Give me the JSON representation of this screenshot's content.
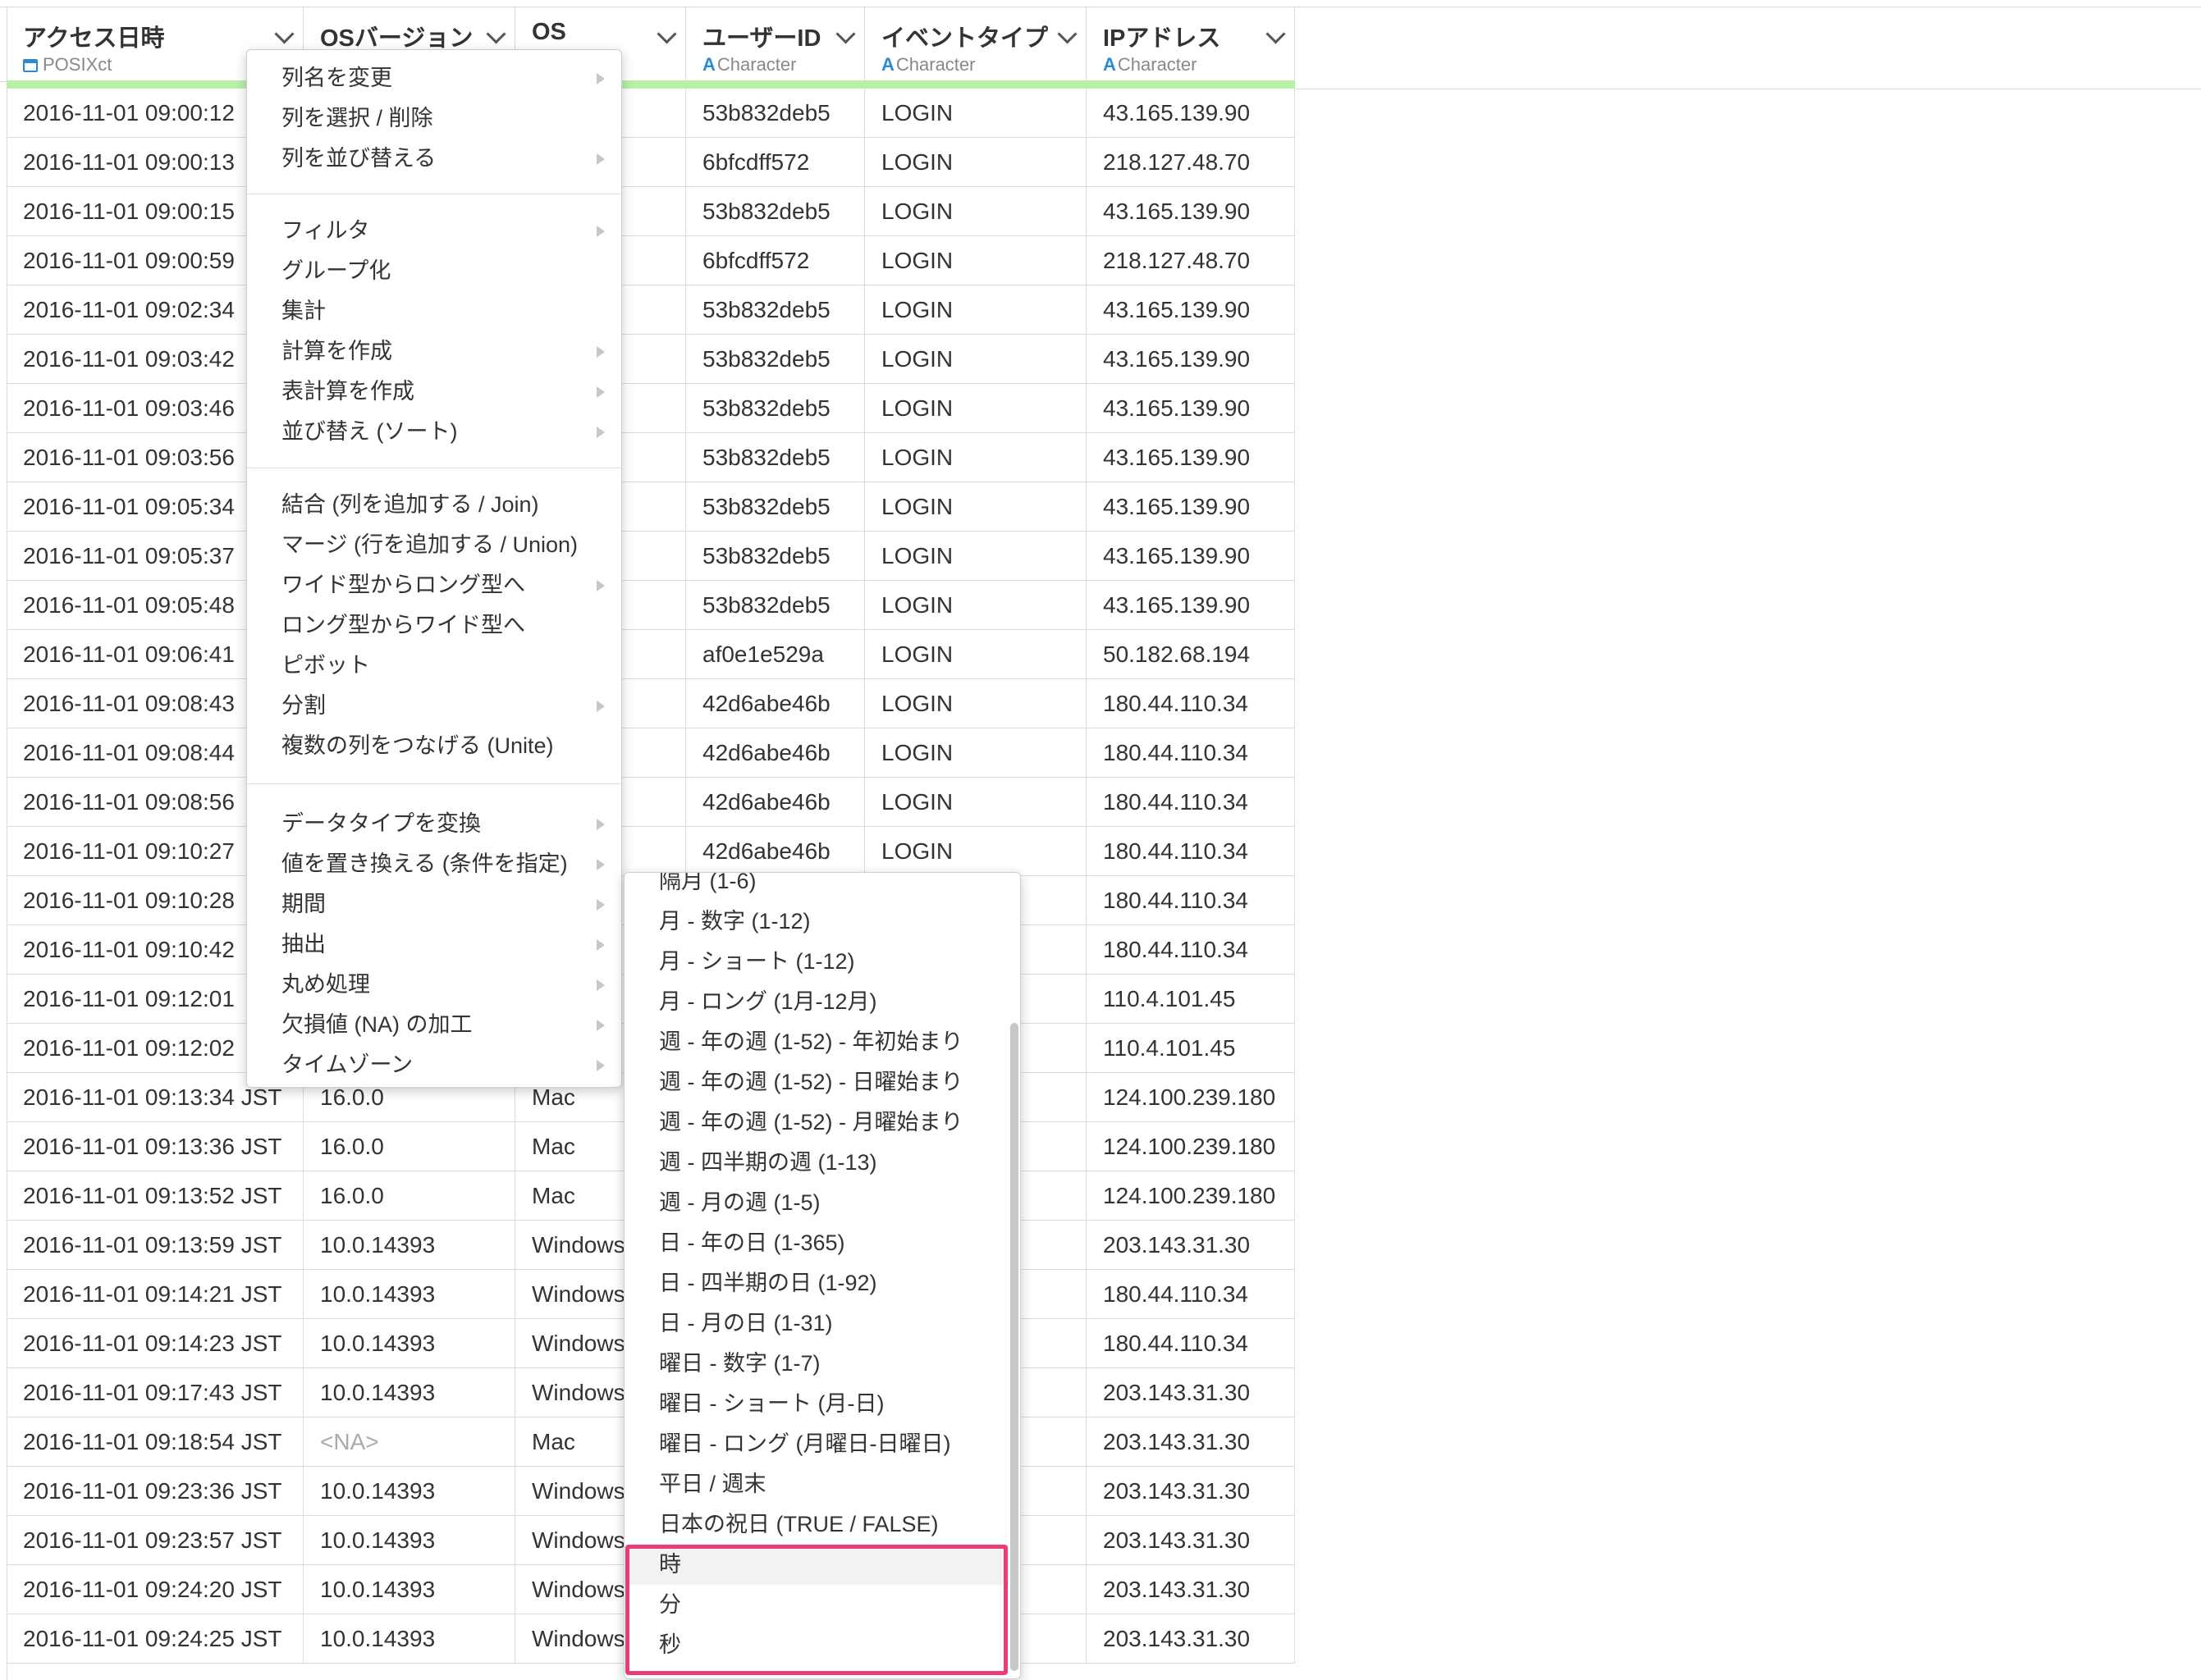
{
  "columns": [
    {
      "title": "アクセス日時",
      "type": "POSIXct",
      "type_icon": "calendar-icon"
    },
    {
      "title": "OSバージョン",
      "type": "",
      "type_icon": ""
    },
    {
      "title": "OS",
      "type": "",
      "type_icon": ""
    },
    {
      "title": "ユーザーID",
      "type": "Character",
      "type_icon": "A"
    },
    {
      "title": "イベントタイプ",
      "type": "Character",
      "type_icon": "A"
    },
    {
      "title": "IPアドレス",
      "type": "Character",
      "type_icon": "A"
    }
  ],
  "rows": [
    [
      "2016-11-01 09:00:12",
      "",
      "",
      "53b832deb5",
      "LOGIN",
      "43.165.139.90"
    ],
    [
      "2016-11-01 09:00:13",
      "",
      "",
      "6bfcdff572",
      "LOGIN",
      "218.127.48.70"
    ],
    [
      "2016-11-01 09:00:15",
      "",
      "",
      "53b832deb5",
      "LOGIN",
      "43.165.139.90"
    ],
    [
      "2016-11-01 09:00:59",
      "",
      "",
      "6bfcdff572",
      "LOGIN",
      "218.127.48.70"
    ],
    [
      "2016-11-01 09:02:34",
      "",
      "",
      "53b832deb5",
      "LOGIN",
      "43.165.139.90"
    ],
    [
      "2016-11-01 09:03:42",
      "",
      "",
      "53b832deb5",
      "LOGIN",
      "43.165.139.90"
    ],
    [
      "2016-11-01 09:03:46",
      "",
      "",
      "53b832deb5",
      "LOGIN",
      "43.165.139.90"
    ],
    [
      "2016-11-01 09:03:56",
      "",
      "",
      "53b832deb5",
      "LOGIN",
      "43.165.139.90"
    ],
    [
      "2016-11-01 09:05:34",
      "",
      "",
      "53b832deb5",
      "LOGIN",
      "43.165.139.90"
    ],
    [
      "2016-11-01 09:05:37",
      "",
      "",
      "53b832deb5",
      "LOGIN",
      "43.165.139.90"
    ],
    [
      "2016-11-01 09:05:48",
      "",
      "",
      "53b832deb5",
      "LOGIN",
      "43.165.139.90"
    ],
    [
      "2016-11-01 09:06:41",
      "",
      "",
      "af0e1e529a",
      "LOGIN",
      "50.182.68.194"
    ],
    [
      "2016-11-01 09:08:43",
      "",
      "",
      "42d6abe46b",
      "LOGIN",
      "180.44.110.34"
    ],
    [
      "2016-11-01 09:08:44",
      "",
      "",
      "42d6abe46b",
      "LOGIN",
      "180.44.110.34"
    ],
    [
      "2016-11-01 09:08:56",
      "",
      "",
      "42d6abe46b",
      "LOGIN",
      "180.44.110.34"
    ],
    [
      "2016-11-01 09:10:27",
      "",
      "",
      "42d6abe46b",
      "LOGIN",
      "180.44.110.34"
    ],
    [
      "2016-11-01 09:10:28",
      "",
      "",
      "",
      "",
      "180.44.110.34"
    ],
    [
      "2016-11-01 09:10:42",
      "",
      "",
      "",
      "",
      "180.44.110.34"
    ],
    [
      "2016-11-01 09:12:01",
      "",
      "",
      "",
      "",
      "110.4.101.45"
    ],
    [
      "2016-11-01 09:12:02",
      "",
      "",
      "",
      "",
      "110.4.101.45"
    ],
    [
      "2016-11-01 09:13:34 JST",
      "16.0.0",
      "Mac",
      "",
      "",
      "124.100.239.180"
    ],
    [
      "2016-11-01 09:13:36 JST",
      "16.0.0",
      "Mac",
      "",
      "",
      "124.100.239.180"
    ],
    [
      "2016-11-01 09:13:52 JST",
      "16.0.0",
      "Mac",
      "",
      "",
      "124.100.239.180"
    ],
    [
      "2016-11-01 09:13:59 JST",
      "10.0.14393",
      "Windows",
      "",
      "",
      "203.143.31.30"
    ],
    [
      "2016-11-01 09:14:21 JST",
      "10.0.14393",
      "Windows",
      "",
      "",
      "180.44.110.34"
    ],
    [
      "2016-11-01 09:14:23 JST",
      "10.0.14393",
      "Windows",
      "",
      "",
      "180.44.110.34"
    ],
    [
      "2016-11-01 09:17:43 JST",
      "10.0.14393",
      "Windows",
      "",
      "",
      "203.143.31.30"
    ],
    [
      "2016-11-01 09:18:54 JST",
      "<NA>",
      "Mac",
      "",
      "",
      "203.143.31.30"
    ],
    [
      "2016-11-01 09:23:36 JST",
      "10.0.14393",
      "Windows",
      "",
      "",
      "203.143.31.30"
    ],
    [
      "2016-11-01 09:23:57 JST",
      "10.0.14393",
      "Windows",
      "",
      "",
      "203.143.31.30"
    ],
    [
      "2016-11-01 09:24:20 JST",
      "10.0.14393",
      "Windows",
      "",
      "",
      "203.143.31.30"
    ],
    [
      "2016-11-01 09:24:25 JST",
      "10.0.14393",
      "Windows",
      "",
      "",
      "203.143.31.30"
    ]
  ],
  "context_menu": {
    "items": [
      {
        "label": "列名を変更",
        "submenu": true
      },
      {
        "label": "列を選択 / 削除",
        "submenu": false
      },
      {
        "label": "列を並び替える",
        "submenu": true
      },
      {
        "label": "フィルタ",
        "submenu": true
      },
      {
        "label": "グループ化",
        "submenu": false
      },
      {
        "label": "集計",
        "submenu": false
      },
      {
        "label": "計算を作成",
        "submenu": true
      },
      {
        "label": "表計算を作成",
        "submenu": true
      },
      {
        "label": "並び替え (ソート)",
        "submenu": true
      },
      {
        "label": "結合 (列を追加する / Join)",
        "submenu": false
      },
      {
        "label": "マージ (行を追加する / Union)",
        "submenu": false
      },
      {
        "label": "ワイド型からロング型へ",
        "submenu": true
      },
      {
        "label": "ロング型からワイド型へ",
        "submenu": false
      },
      {
        "label": "ピボット",
        "submenu": false
      },
      {
        "label": "分割",
        "submenu": true
      },
      {
        "label": "複数の列をつなげる (Unite)",
        "submenu": false
      },
      {
        "label": "データタイプを変換",
        "submenu": true
      },
      {
        "label": "値を置き換える (条件を指定)",
        "submenu": true
      },
      {
        "label": "期間",
        "submenu": true
      },
      {
        "label": "抽出",
        "submenu": true
      },
      {
        "label": "丸め処理",
        "submenu": true
      },
      {
        "label": "欠損値 (NA) の加工",
        "submenu": true
      },
      {
        "label": "タイムゾーン",
        "submenu": true
      }
    ]
  },
  "extract_submenu": {
    "items": [
      "隔月 (1-6)",
      "月 - 数字 (1-12)",
      "月 - ショート (1-12)",
      "月 - ロング (1月-12月)",
      "週 - 年の週 (1-52) - 年初始まり",
      "週 - 年の週 (1-52) - 日曜始まり",
      "週 - 年の週 (1-52) - 月曜始まり",
      "週 - 四半期の週 (1-13)",
      "週 - 月の週 (1-5)",
      "日 - 年の日 (1-365)",
      "日 - 四半期の日 (1-92)",
      "日 - 月の日 (1-31)",
      "曜日 - 数字 (1-7)",
      "曜日 - ショート (月-日)",
      "曜日 - ロング (月曜日-日曜日)",
      "平日 / 週末",
      "日本の祝日 (TRUE / FALSE)",
      "時",
      "分",
      "秒"
    ],
    "hovered": "時"
  },
  "colors": {
    "accent_blue": "#2a8ad6",
    "highlight_pink": "#ea3b7a",
    "header_bar_green": "#b8f0a8"
  }
}
